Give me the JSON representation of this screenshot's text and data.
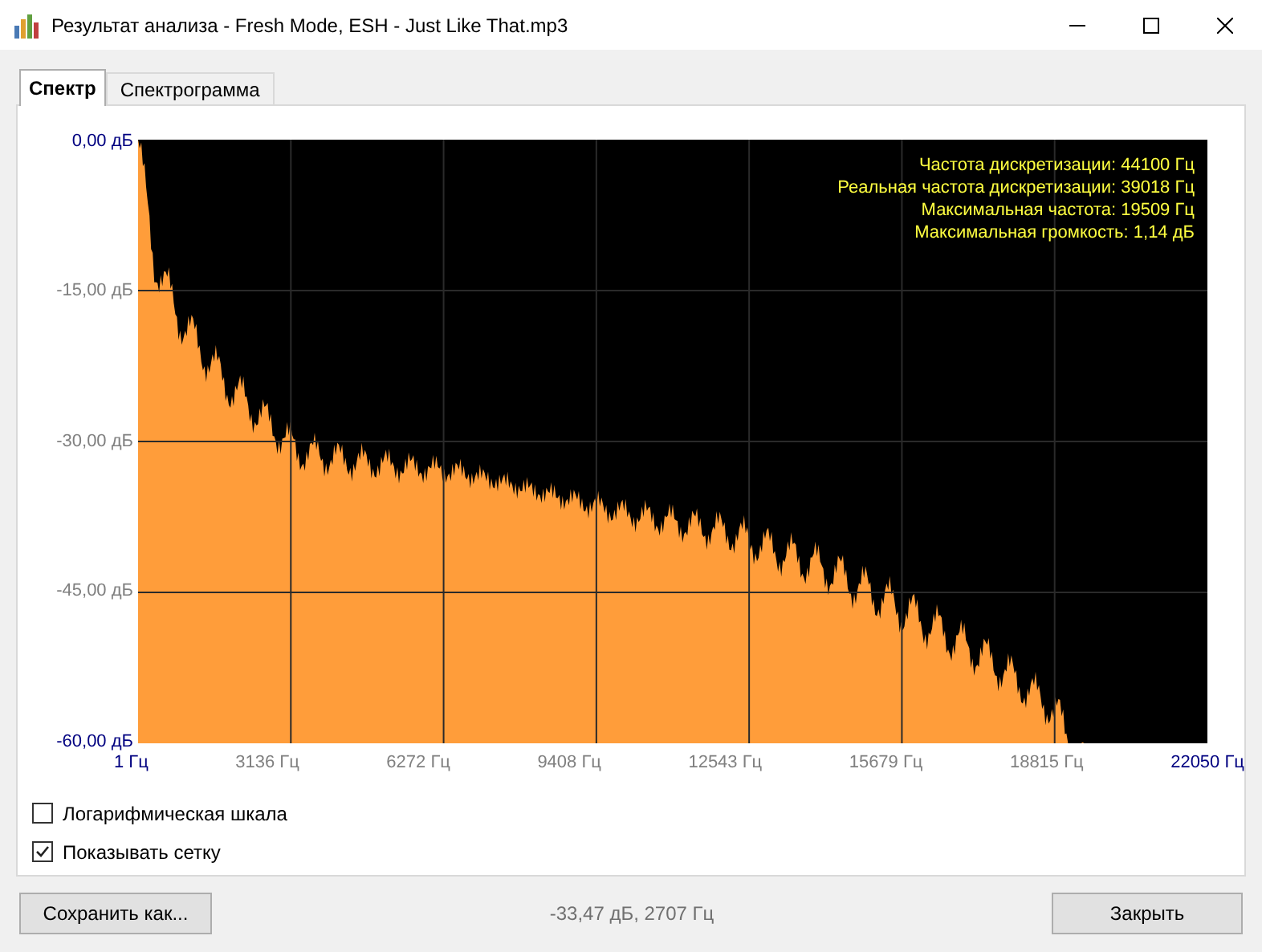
{
  "window": {
    "title": "Результат анализа - Fresh Mode, ESH - Just Like That.mp3"
  },
  "tabs": [
    {
      "label": "Спектр",
      "selected": true
    },
    {
      "label": "Спектрограмма",
      "selected": false
    }
  ],
  "spectrum": {
    "y_labels": [
      "0,00 дБ",
      "-15,00 дБ",
      "-30,00 дБ",
      "-45,00 дБ",
      "-60,00 дБ"
    ],
    "x_labels": [
      "1 Гц",
      "3136 Гц",
      "6272 Гц",
      "9408 Гц",
      "12543 Гц",
      "15679 Гц",
      "18815 Гц",
      "22050 Гц"
    ],
    "info": [
      "Частота дискретизации: 44100 Гц",
      "Реальная частота дискретизации: 39018 Гц",
      "Максимальная частота: 19509 Гц",
      "Максимальная громкость: 1,14 дБ"
    ]
  },
  "options": [
    {
      "label": "Логарифмическая шкала",
      "checked": false
    },
    {
      "label": "Показывать сетку",
      "checked": true
    }
  ],
  "save_button": "Сохранить как...",
  "status": "-33,47 дБ, 2707 Гц",
  "close_button": "Закрыть"
}
